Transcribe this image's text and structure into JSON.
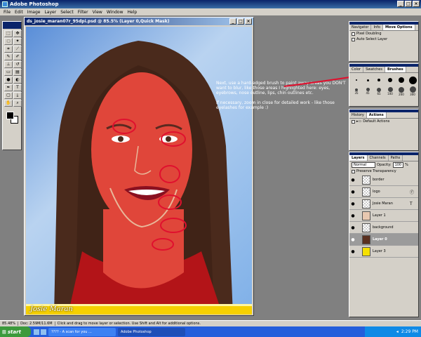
{
  "app": {
    "title": "Adobe Photoshop"
  },
  "menu": [
    "File",
    "Edit",
    "Image",
    "Layer",
    "Select",
    "Filter",
    "View",
    "Window",
    "Help"
  ],
  "document": {
    "title": "ds_josie_maran07r_95dpi.psd @ 85.5% (Layer 0,Quick Mask)",
    "caption": "Josie Maran"
  },
  "annotation": {
    "para1": "Next, use a hard-edged brush to paint away areas you DON'T want to blur, like those areas I highlighted here: eyes, eyebrows, nose outline, lips, chin outlines etc.",
    "para2": "If necessary, zoom in close for detailed work - like those eyelashes for example :)"
  },
  "options_panel": {
    "tabs": [
      "Navigator",
      "Info",
      "Move Options"
    ],
    "options": [
      "Pixel Doubling",
      "Auto Select Layer"
    ]
  },
  "brushes_panel": {
    "tabs": [
      "Color",
      "Swatches",
      "Brushes"
    ],
    "sizes": [
      "35",
      "45",
      "65",
      "100",
      "200",
      "300"
    ]
  },
  "history_panel": {
    "tabs": [
      "History",
      "Actions"
    ],
    "item": "Default Actions"
  },
  "layers_panel": {
    "tabs": [
      "Layers",
      "Channels",
      "Paths"
    ],
    "blend_mode": "Normal",
    "opacity_label": "Opacity:",
    "opacity_value": "100",
    "opacity_unit": "%",
    "preserve_label": "Preserve Transparency",
    "layers": [
      {
        "name": "border",
        "active": false
      },
      {
        "name": "logo",
        "active": false
      },
      {
        "name": "Josie Maran",
        "active": false
      },
      {
        "name": "Layer 1",
        "active": false
      },
      {
        "name": "background",
        "active": false
      },
      {
        "name": "Layer 0",
        "active": true
      },
      {
        "name": "Layer 3",
        "active": false
      }
    ]
  },
  "status": {
    "zoom": "85.48%",
    "doc": "Doc: 2.59M/11.6M",
    "hint": "Click and drag to move layer or selection. Use Shift and Alt for additional options."
  },
  "taskbar": {
    "start": "start",
    "tasks": [
      "???? - A scan for you ...",
      "Adobe Photoshop"
    ],
    "clock": "2:29 PM"
  },
  "colors": {
    "mask_red": "#e0463a",
    "title_blue": "#0a246a",
    "annot_circle": "#e0102e"
  },
  "icons": [
    "photoshop-icon",
    "eye-icon",
    "brush-icon",
    "move-icon"
  ]
}
